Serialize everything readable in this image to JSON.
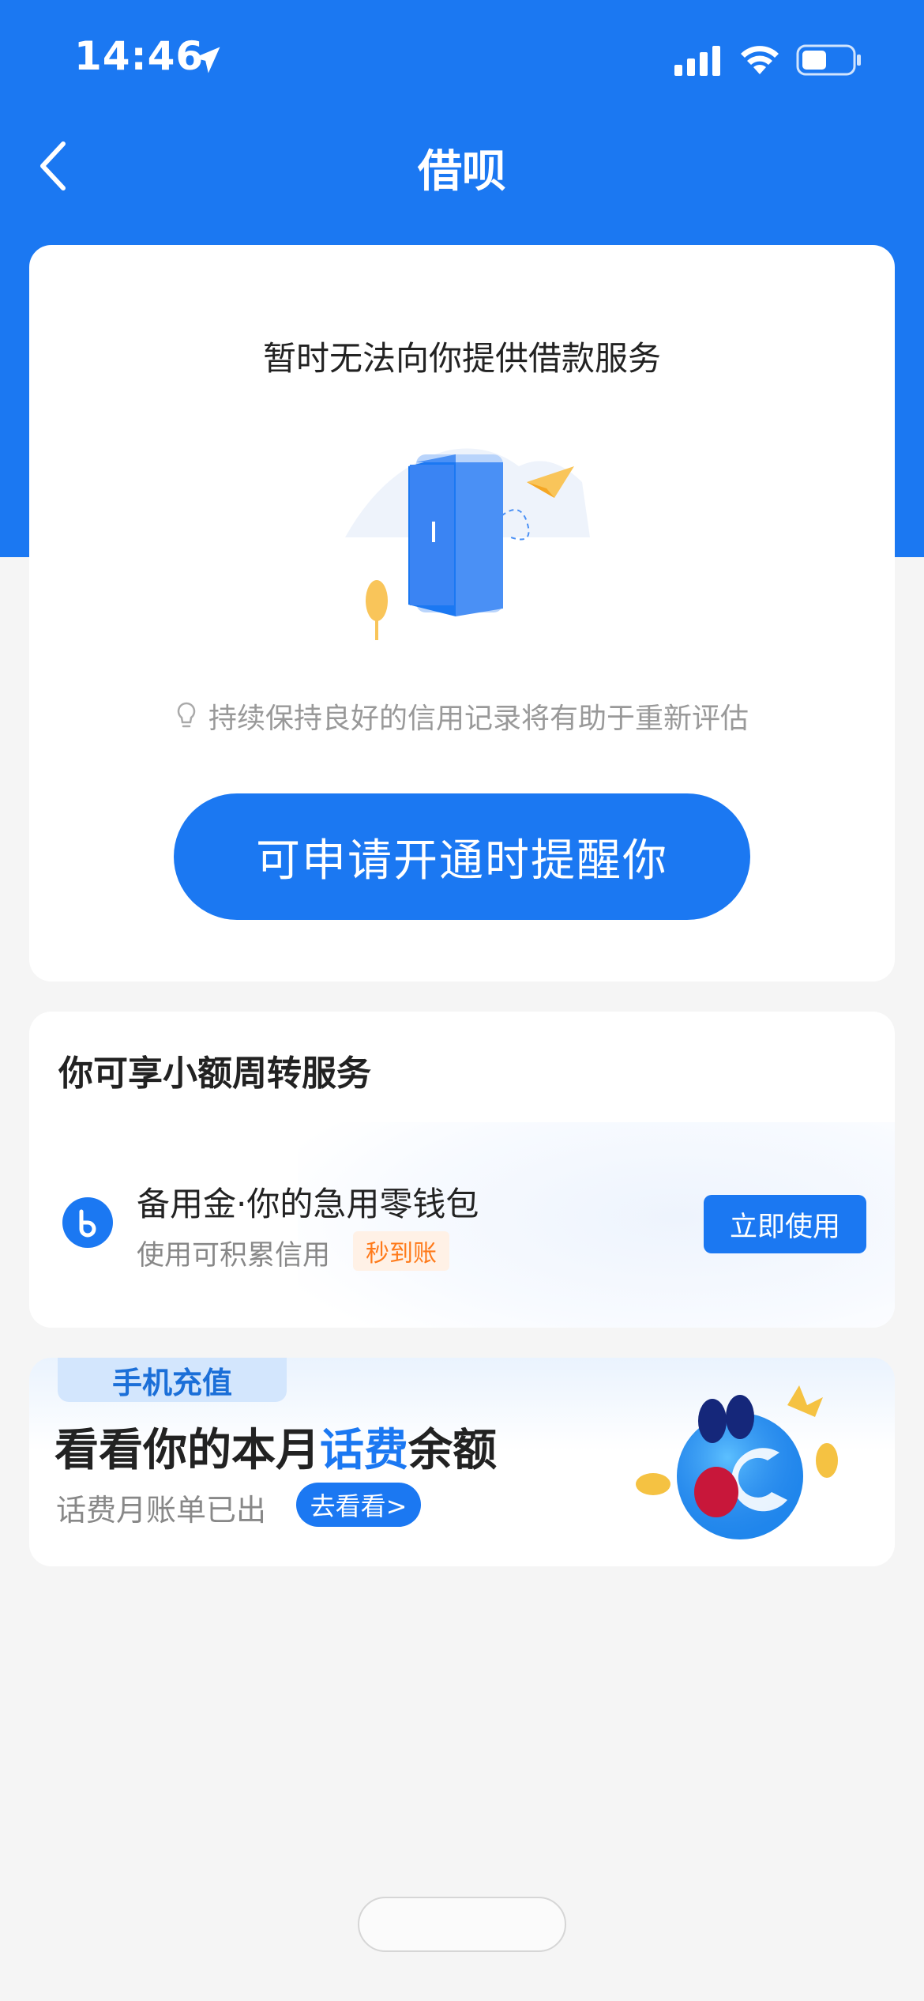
{
  "status_bar": {
    "time": "14:46",
    "icons": [
      "location-arrow-icon",
      "signal-icon",
      "wifi-icon",
      "battery-icon"
    ]
  },
  "nav": {
    "back_icon": "chevron-left-icon",
    "title": "借呗"
  },
  "main_card": {
    "message": "暂时无法向你提供借款服务",
    "tip": "持续保持良好的信用记录将有助于重新评估",
    "button_label": "可申请开通时提醒你"
  },
  "small_loan": {
    "title": "你可享小额周转服务",
    "service_name": "备用金·你的急用零钱包",
    "service_desc": "使用可积累信用",
    "tag": "秒到账",
    "button_label": "立即使用"
  },
  "promo": {
    "tag": "手机充值",
    "title_pre": "看看你的本月",
    "title_highlight": "话费",
    "title_post": "余额",
    "subtitle": "话费月账单已出",
    "button_label": "去看看>"
  },
  "colors": {
    "brand_blue": "#1b78f2",
    "tag_orange": "#ff7a1a",
    "background": "#f5f5f5"
  }
}
